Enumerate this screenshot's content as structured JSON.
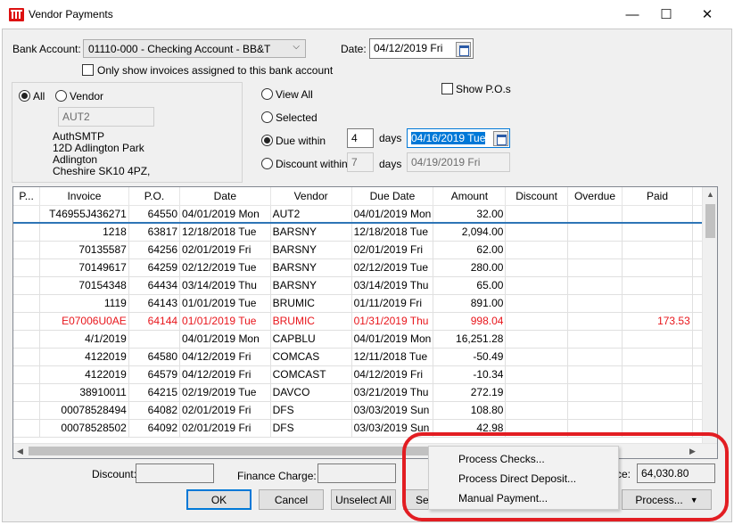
{
  "window": {
    "title": "Vendor Payments",
    "minimize": "—",
    "maximize": "☐",
    "close": "✕"
  },
  "header": {
    "bank_account_label": "Bank Account:",
    "bank_account_value": "01110-000 - Checking Account - BB&T",
    "date_label": "Date:",
    "date_value": "04/12/2019 Fri",
    "only_show_label": "Only show invoices assigned to this bank account",
    "only_show_checked": false
  },
  "vendor_filter": {
    "all_label": "All",
    "vendor_label": "Vendor",
    "selected": "All",
    "vendor_code": "AUT2",
    "address": [
      "AuthSMTP",
      "12D Adlington Park",
      "Adlington",
      "Cheshire SK10 4PZ,"
    ]
  },
  "view_filter": {
    "view_all_label": "View All",
    "selected_label": "Selected",
    "due_within_label": "Due within",
    "due_within_days": "4",
    "due_within_date": "04/16/2019 Tue",
    "discount_within_label": "Discount within",
    "discount_within_days": "7",
    "discount_within_date": "04/19/2019 Fri",
    "days_label": "days",
    "selected_option": "Due within",
    "show_pos_label": "Show P.O.s",
    "show_pos_checked": false
  },
  "grid": {
    "columns": [
      "P...",
      "Invoice",
      "P.O.",
      "Date",
      "Vendor",
      "Due Date",
      "Amount",
      "Discount",
      "Overdue",
      "Paid"
    ],
    "rows": [
      {
        "p": "",
        "invoice": "T46955J436271",
        "po": "64550",
        "date": "04/01/2019 Mon",
        "vendor": "AUT2",
        "due": "04/01/2019 Mon",
        "amount": "32.00",
        "discount": "",
        "overdue": "",
        "paid": "",
        "red": false
      },
      {
        "p": "",
        "invoice": "1218",
        "po": "63817",
        "date": "12/18/2018 Tue",
        "vendor": "BARSNY",
        "due": "12/18/2018 Tue",
        "amount": "2,094.00",
        "discount": "",
        "overdue": "",
        "paid": "",
        "red": false
      },
      {
        "p": "",
        "invoice": "70135587",
        "po": "64256",
        "date": "02/01/2019 Fri",
        "vendor": "BARSNY",
        "due": "02/01/2019 Fri",
        "amount": "62.00",
        "discount": "",
        "overdue": "",
        "paid": "",
        "red": false
      },
      {
        "p": "",
        "invoice": "70149617",
        "po": "64259",
        "date": "02/12/2019 Tue",
        "vendor": "BARSNY",
        "due": "02/12/2019 Tue",
        "amount": "280.00",
        "discount": "",
        "overdue": "",
        "paid": "",
        "red": false
      },
      {
        "p": "",
        "invoice": "70154348",
        "po": "64434",
        "date": "03/14/2019 Thu",
        "vendor": "BARSNY",
        "due": "03/14/2019 Thu",
        "amount": "65.00",
        "discount": "",
        "overdue": "",
        "paid": "",
        "red": false
      },
      {
        "p": "",
        "invoice": "1119",
        "po": "64143",
        "date": "01/01/2019 Tue",
        "vendor": "BRUMIC",
        "due": "01/11/2019 Fri",
        "amount": "891.00",
        "discount": "",
        "overdue": "",
        "paid": "",
        "red": false
      },
      {
        "p": "",
        "invoice": "E07006U0AE",
        "po": "64144",
        "date": "01/01/2019 Tue",
        "vendor": "BRUMIC",
        "due": "01/31/2019 Thu",
        "amount": "998.04",
        "discount": "",
        "overdue": "",
        "paid": "173.53",
        "red": true
      },
      {
        "p": "",
        "invoice": "4/1/2019",
        "po": "",
        "date": "04/01/2019 Mon",
        "vendor": "CAPBLU",
        "due": "04/01/2019 Mon",
        "amount": "16,251.28",
        "discount": "",
        "overdue": "",
        "paid": "",
        "red": false
      },
      {
        "p": "",
        "invoice": "4122019",
        "po": "64580",
        "date": "04/12/2019 Fri",
        "vendor": "COMCAS",
        "due": "12/11/2018 Tue",
        "amount": "-50.49",
        "discount": "",
        "overdue": "",
        "paid": "",
        "red": false
      },
      {
        "p": "",
        "invoice": "4122019",
        "po": "64579",
        "date": "04/12/2019 Fri",
        "vendor": "COMCAST",
        "due": "04/12/2019 Fri",
        "amount": "-10.34",
        "discount": "",
        "overdue": "",
        "paid": "",
        "red": false
      },
      {
        "p": "",
        "invoice": "38910011",
        "po": "64215",
        "date": "02/19/2019 Tue",
        "vendor": "DAVCO",
        "due": "03/21/2019 Thu",
        "amount": "272.19",
        "discount": "",
        "overdue": "",
        "paid": "",
        "red": false
      },
      {
        "p": "",
        "invoice": "00078528494",
        "po": "64082",
        "date": "02/01/2019 Fri",
        "vendor": "DFS",
        "due": "03/03/2019 Sun",
        "amount": "108.80",
        "discount": "",
        "overdue": "",
        "paid": "",
        "red": false
      },
      {
        "p": "",
        "invoice": "00078528502",
        "po": "64092",
        "date": "02/01/2019 Fri",
        "vendor": "DFS",
        "due": "03/03/2019 Sun",
        "amount": "42.98",
        "discount": "",
        "overdue": "",
        "paid": "",
        "red": false
      }
    ]
  },
  "footer": {
    "discount_label": "Discount:",
    "discount_value": "",
    "finance_charge_label": "Finance Charge:",
    "finance_charge_value": "",
    "balance_label_fragment": "ce:",
    "balance_value": "64,030.80",
    "ok_label": "OK",
    "cancel_label": "Cancel",
    "unselect_all_label": "Unselect All",
    "select_partial_label": "Se",
    "process_label": "Process...",
    "process_arrow": "▼"
  },
  "context_menu": {
    "items": [
      "Process Checks...",
      "Process Direct Deposit...",
      "Manual Payment..."
    ]
  },
  "colors": {
    "accent": "#0078d7",
    "alert_red": "#e8151b",
    "annotation_red": "#e21d22",
    "selection_blue": "#0078d7"
  }
}
